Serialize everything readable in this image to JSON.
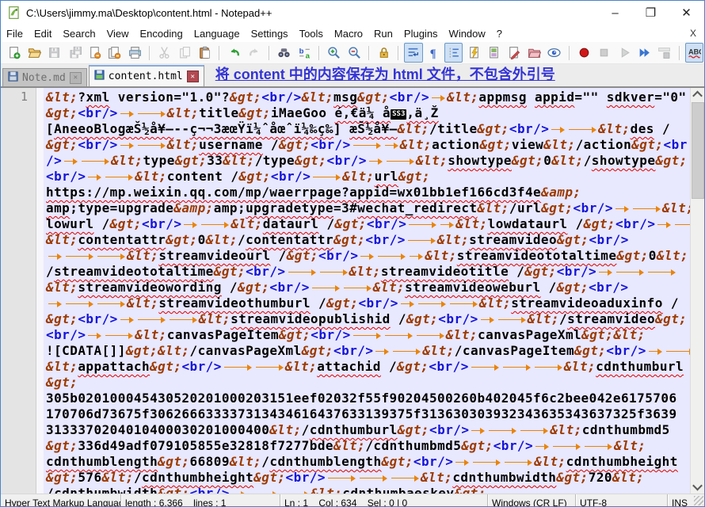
{
  "window": {
    "title": "C:\\Users\\jimmy.ma\\Desktop\\content.html - Notepad++",
    "minimize": "–",
    "maximize": "❐",
    "close": "✕"
  },
  "menu": {
    "items": [
      "File",
      "Edit",
      "Search",
      "View",
      "Encoding",
      "Language",
      "Settings",
      "Tools",
      "Macro",
      "Run",
      "Plugins",
      "Window",
      "?"
    ],
    "close_x": "X"
  },
  "toolbar": {
    "items": [
      {
        "name": "new-file"
      },
      {
        "name": "open-file"
      },
      {
        "name": "save-file",
        "disabled": true
      },
      {
        "name": "save-all",
        "disabled": true
      },
      {
        "name": "close-file"
      },
      {
        "name": "close-all"
      },
      {
        "name": "print"
      },
      {
        "sep": true
      },
      {
        "name": "cut",
        "disabled": true
      },
      {
        "name": "copy",
        "disabled": true
      },
      {
        "name": "paste"
      },
      {
        "sep": true
      },
      {
        "name": "undo"
      },
      {
        "name": "redo",
        "disabled": true
      },
      {
        "sep": true
      },
      {
        "name": "find"
      },
      {
        "name": "replace"
      },
      {
        "sep": true
      },
      {
        "name": "zoom-in"
      },
      {
        "name": "zoom-out"
      },
      {
        "sep": true
      },
      {
        "name": "sync-lock"
      },
      {
        "sep": true
      },
      {
        "name": "word-wrap",
        "active": true
      },
      {
        "name": "show-all-characters"
      },
      {
        "name": "indent-guide",
        "active": true
      },
      {
        "name": "user-language"
      },
      {
        "name": "document-map"
      },
      {
        "name": "document-edit"
      },
      {
        "name": "folder-workspace"
      },
      {
        "name": "file-monitoring"
      },
      {
        "sep": true
      },
      {
        "name": "macro-record"
      },
      {
        "name": "macro-stop",
        "disabled": true
      },
      {
        "name": "macro-play",
        "disabled": true
      },
      {
        "name": "macro-run-multiple"
      },
      {
        "name": "macro-save",
        "disabled": true
      },
      {
        "sep": true
      },
      {
        "name": "spell-check",
        "active": true
      }
    ]
  },
  "tabbar": {
    "tabs": [
      {
        "label": "Note.md",
        "state": "inactive",
        "close": "x"
      },
      {
        "label": "content.html",
        "state": "active",
        "close": "x"
      }
    ],
    "note": "将 content 中的内容保存为 html 文件，不包含外引号"
  },
  "editor": {
    "line_number": "1",
    "rows": [
      [
        [
          "e",
          "&lt;"
        ],
        [
          "t",
          "?"
        ],
        [
          "m",
          "xml"
        ],
        [
          "t",
          " version=\"1.0\"?"
        ],
        [
          "e",
          "&gt;"
        ],
        [
          "b",
          "<br/>"
        ],
        [
          "e",
          "&lt;"
        ],
        [
          "m",
          "msg"
        ],
        [
          "e",
          "&gt;"
        ],
        [
          "b",
          "<br/>"
        ],
        [
          "a"
        ],
        [
          "e",
          "&lt;"
        ],
        [
          "m",
          "appmsg"
        ],
        [
          "t",
          " "
        ],
        [
          "m",
          "appid"
        ],
        [
          "t",
          "=\"\" "
        ],
        [
          "m",
          "sdkver"
        ],
        [
          "t",
          "=\"0\""
        ]
      ],
      [
        [
          "e",
          "&gt;"
        ],
        [
          "b",
          "<br/>"
        ],
        [
          "a"
        ],
        [
          "A"
        ],
        [
          "e",
          "&lt;"
        ],
        [
          "t",
          "title"
        ],
        [
          "e",
          "&gt;"
        ],
        [
          "t",
          "iMaeGoo "
        ],
        [
          "m",
          "é‚€ä¼ å"
        ],
        [
          "k",
          "SS3"
        ],
        [
          "m",
          "‚ä¸Ž"
        ]
      ],
      [
        [
          "t",
          "["
        ],
        [
          "m",
          "AneeoBlogæŠ½å¥–"
        ],
        [
          "t",
          "--"
        ],
        [
          "m",
          "ç¬¬3æœŸï¼ˆåœˆï¼‰ç­‰"
        ],
        [
          "t",
          "] "
        ],
        [
          "m",
          "æŠ½å¥–"
        ],
        [
          "e",
          "&lt;"
        ],
        [
          "t",
          "/title"
        ],
        [
          "e",
          "&gt;"
        ],
        [
          "b",
          "<br/>"
        ],
        [
          "a"
        ],
        [
          "A"
        ],
        [
          "e",
          "&lt;"
        ],
        [
          "m",
          "des"
        ],
        [
          "t",
          " /"
        ]
      ],
      [
        [
          "e",
          "&gt;"
        ],
        [
          "b",
          "<br/>"
        ],
        [
          "a"
        ],
        [
          "A"
        ],
        [
          "e",
          "&lt;"
        ],
        [
          "m",
          "username"
        ],
        [
          "t",
          " /"
        ],
        [
          "e",
          "&gt;"
        ],
        [
          "b",
          "<br/>"
        ],
        [
          "A"
        ],
        [
          "a"
        ],
        [
          "e",
          "&lt;"
        ],
        [
          "t",
          "action"
        ],
        [
          "e",
          "&gt;"
        ],
        [
          "t",
          "view"
        ],
        [
          "e",
          "&lt;"
        ],
        [
          "t",
          "/action"
        ],
        [
          "e",
          "&gt;"
        ],
        [
          "b",
          "<br"
        ]
      ],
      [
        [
          "b",
          "/>"
        ],
        [
          "a"
        ],
        [
          "A"
        ],
        [
          "e",
          "&lt;"
        ],
        [
          "t",
          "type"
        ],
        [
          "e",
          "&gt;"
        ],
        [
          "t",
          "33"
        ],
        [
          "e",
          "&lt;"
        ],
        [
          "t",
          "/type"
        ],
        [
          "e",
          "&gt;"
        ],
        [
          "b",
          "<br/>"
        ],
        [
          "a"
        ],
        [
          "A"
        ],
        [
          "e",
          "&lt;"
        ],
        [
          "m",
          "showtype"
        ],
        [
          "e",
          "&gt;"
        ],
        [
          "t",
          "0"
        ],
        [
          "e",
          "&lt;"
        ],
        [
          "t",
          "/"
        ],
        [
          "m",
          "showtype"
        ],
        [
          "e",
          "&gt;"
        ]
      ],
      [
        [
          "b",
          "<br/>"
        ],
        [
          "a"
        ],
        [
          "A"
        ],
        [
          "e",
          "&lt;"
        ],
        [
          "t",
          "content /"
        ],
        [
          "e",
          "&gt;"
        ],
        [
          "b",
          "<br/>"
        ],
        [
          "A"
        ],
        [
          "e",
          "&lt;"
        ],
        [
          "m",
          "url"
        ],
        [
          "e",
          "&gt;"
        ]
      ],
      [
        [
          "m",
          "https://mp.weixin.qq.com/mp/waerrpage?appid=wx01bb1ef166cd3f4e"
        ],
        [
          "e",
          "&amp;"
        ]
      ],
      [
        [
          "m",
          "amp"
        ],
        [
          "t",
          ";type=upgrade"
        ],
        [
          "e",
          "&amp;"
        ],
        [
          "t",
          "amp;"
        ],
        [
          "m",
          "upgradetype"
        ],
        [
          "t",
          "=3#"
        ],
        [
          "m",
          "wechat_redirect"
        ],
        [
          "e",
          "&lt;"
        ],
        [
          "t",
          "/url"
        ],
        [
          "e",
          "&gt;"
        ],
        [
          "b",
          "<br/>"
        ],
        [
          "a"
        ],
        [
          "A"
        ],
        [
          "e",
          "&lt;"
        ]
      ],
      [
        [
          "m",
          "lowurl"
        ],
        [
          "t",
          " /"
        ],
        [
          "e",
          "&gt;"
        ],
        [
          "b",
          "<br/>"
        ],
        [
          "a"
        ],
        [
          "A"
        ],
        [
          "e",
          "&lt;"
        ],
        [
          "m",
          "dataurl"
        ],
        [
          "t",
          " /"
        ],
        [
          "e",
          "&gt;"
        ],
        [
          "b",
          "<br/>"
        ],
        [
          "A"
        ],
        [
          "a"
        ],
        [
          "e",
          "&lt;"
        ],
        [
          "m",
          "lowdataurl"
        ],
        [
          "t",
          " /"
        ],
        [
          "e",
          "&gt;"
        ],
        [
          "b",
          "<br/>"
        ],
        [
          "a"
        ],
        [
          "A"
        ]
      ],
      [
        [
          "e",
          "&lt;"
        ],
        [
          "m",
          "contentattr"
        ],
        [
          "e",
          "&gt;"
        ],
        [
          "t",
          "0"
        ],
        [
          "e",
          "&lt;"
        ],
        [
          "t",
          "/"
        ],
        [
          "m",
          "contentattr"
        ],
        [
          "e",
          "&gt;"
        ],
        [
          "b",
          "<br/>"
        ],
        [
          "A"
        ],
        [
          "e",
          "&lt;"
        ],
        [
          "m",
          "streamvideo"
        ],
        [
          "e",
          "&gt;"
        ],
        [
          "b",
          "<br/>"
        ]
      ],
      [
        [
          "a"
        ],
        [
          "A"
        ],
        [
          "A"
        ],
        [
          "e",
          "&lt;"
        ],
        [
          "m",
          "streamvideourl"
        ],
        [
          "t",
          " /"
        ],
        [
          "e",
          "&gt;"
        ],
        [
          "b",
          "<br/>"
        ],
        [
          "a"
        ],
        [
          "A"
        ],
        [
          "a"
        ],
        [
          "e",
          "&lt;"
        ],
        [
          "m",
          "streamvideototaltime"
        ],
        [
          "e",
          "&gt;"
        ],
        [
          "t",
          "0"
        ],
        [
          "e",
          "&lt;"
        ]
      ],
      [
        [
          "t",
          "/"
        ],
        [
          "m",
          "streamvideototaltime"
        ],
        [
          "e",
          "&gt;"
        ],
        [
          "b",
          "<br/>"
        ],
        [
          "A"
        ],
        [
          "A"
        ],
        [
          "e",
          "&lt;"
        ],
        [
          "m",
          "streamvideotitle"
        ],
        [
          "t",
          " /"
        ],
        [
          "e",
          "&gt;"
        ],
        [
          "b",
          "<br/>"
        ],
        [
          "a"
        ],
        [
          "A"
        ],
        [
          "A"
        ]
      ],
      [
        [
          "e",
          "&lt;"
        ],
        [
          "m",
          "streamvideowording"
        ],
        [
          "t",
          " /"
        ],
        [
          "e",
          "&gt;"
        ],
        [
          "b",
          "<br/>"
        ],
        [
          "A"
        ],
        [
          "A"
        ],
        [
          "e",
          "&lt;"
        ],
        [
          "m",
          "streamvideoweburl"
        ],
        [
          "t",
          " /"
        ],
        [
          "e",
          "&gt;"
        ],
        [
          "b",
          "<br/>"
        ]
      ],
      [
        [
          "a"
        ],
        [
          "A"
        ],
        [
          "A"
        ],
        [
          "e",
          "&lt;"
        ],
        [
          "m",
          "streamvideothumburl"
        ],
        [
          "t",
          " /"
        ],
        [
          "e",
          "&gt;"
        ],
        [
          "b",
          "<br/>"
        ],
        [
          "a"
        ],
        [
          "A"
        ],
        [
          "A"
        ],
        [
          "e",
          "&lt;"
        ],
        [
          "m",
          "streamvideoaduxinfo"
        ],
        [
          "t",
          " /"
        ]
      ],
      [
        [
          "e",
          "&gt;"
        ],
        [
          "b",
          "<br/>"
        ],
        [
          "a"
        ],
        [
          "A"
        ],
        [
          "A"
        ],
        [
          "e",
          "&lt;"
        ],
        [
          "m",
          "streamvideopublishid"
        ],
        [
          "t",
          " /"
        ],
        [
          "e",
          "&gt;"
        ],
        [
          "b",
          "<br/>"
        ],
        [
          "a"
        ],
        [
          "A"
        ],
        [
          "e",
          "&lt;"
        ],
        [
          "t",
          "/"
        ],
        [
          "m",
          "streamvideo"
        ],
        [
          "e",
          "&gt;"
        ]
      ],
      [
        [
          "b",
          "<br/>"
        ],
        [
          "a"
        ],
        [
          "A"
        ],
        [
          "e",
          "&lt;"
        ],
        [
          "t",
          "canvasPageItem"
        ],
        [
          "e",
          "&gt;"
        ],
        [
          "b",
          "<br/>"
        ],
        [
          "A"
        ],
        [
          "A"
        ],
        [
          "A"
        ],
        [
          "e",
          "&lt;"
        ],
        [
          "t",
          "canvasPageXml"
        ],
        [
          "e",
          "&gt;"
        ],
        [
          "e",
          "&lt;"
        ]
      ],
      [
        [
          "t",
          "![CDATA[]]"
        ],
        [
          "e",
          "&gt;"
        ],
        [
          "e",
          "&lt;"
        ],
        [
          "t",
          "/canvasPageXml"
        ],
        [
          "e",
          "&gt;"
        ],
        [
          "b",
          "<br/>"
        ],
        [
          "a"
        ],
        [
          "A"
        ],
        [
          "e",
          "&lt;"
        ],
        [
          "t",
          "/canvasPageItem"
        ],
        [
          "e",
          "&gt;"
        ],
        [
          "b",
          "<br/>"
        ],
        [
          "a"
        ],
        [
          "A"
        ]
      ],
      [
        [
          "e",
          "&lt;"
        ],
        [
          "m",
          "appattach"
        ],
        [
          "e",
          "&gt;"
        ],
        [
          "b",
          "<br/>"
        ],
        [
          "A"
        ],
        [
          "A"
        ],
        [
          "e",
          "&lt;"
        ],
        [
          "m",
          "attachid"
        ],
        [
          "t",
          " /"
        ],
        [
          "e",
          "&gt;"
        ],
        [
          "b",
          "<br/>"
        ],
        [
          "A"
        ],
        [
          "A"
        ],
        [
          "A"
        ],
        [
          "e",
          "&lt;"
        ],
        [
          "m",
          "cdnthumburl"
        ]
      ],
      [
        [
          "e",
          "&gt;"
        ]
      ],
      [
        [
          "t",
          "305b020100045430520201000203151eef02032f55f90204500260b402045f6c2bee042e6175706"
        ]
      ],
      [
        [
          "t",
          "170706d73675f306266633337313434616437633139375f313630303932343635343637325f3639"
        ]
      ],
      [
        [
          "t",
          "3133370204010400030201000400"
        ],
        [
          "e",
          "&lt;"
        ],
        [
          "t",
          "/"
        ],
        [
          "m",
          "cdnthumburl"
        ],
        [
          "e",
          "&gt;"
        ],
        [
          "b",
          "<br/>"
        ],
        [
          "a"
        ],
        [
          "A"
        ],
        [
          "A"
        ],
        [
          "e",
          "&lt;"
        ],
        [
          "t",
          "cdnthumbmd5"
        ]
      ],
      [
        [
          "e",
          "&gt;"
        ],
        [
          "t",
          "336d49adf079105855e32818f7277bde"
        ],
        [
          "e",
          "&lt;"
        ],
        [
          "t",
          "/cdnthumbmd5"
        ],
        [
          "e",
          "&gt;"
        ],
        [
          "b",
          "<br/>"
        ],
        [
          "a"
        ],
        [
          "A"
        ],
        [
          "A"
        ],
        [
          "e",
          "&lt;"
        ]
      ],
      [
        [
          "m",
          "cdnthumblength"
        ],
        [
          "e",
          "&gt;"
        ],
        [
          "t",
          "66809"
        ],
        [
          "e",
          "&lt;"
        ],
        [
          "t",
          "/"
        ],
        [
          "m",
          "cdnthumblength"
        ],
        [
          "e",
          "&gt;"
        ],
        [
          "b",
          "<br/>"
        ],
        [
          "a"
        ],
        [
          "A"
        ],
        [
          "A"
        ],
        [
          "e",
          "&lt;"
        ],
        [
          "m",
          "cdnthumbheight"
        ]
      ],
      [
        [
          "e",
          "&gt;"
        ],
        [
          "t",
          "576"
        ],
        [
          "e",
          "&lt;"
        ],
        [
          "t",
          "/"
        ],
        [
          "m",
          "cdnthumbheight"
        ],
        [
          "e",
          "&gt;"
        ],
        [
          "b",
          "<br/>"
        ],
        [
          "A"
        ],
        [
          "A"
        ],
        [
          "A"
        ],
        [
          "e",
          "&lt;"
        ],
        [
          "m",
          "cdnthumbwidth"
        ],
        [
          "e",
          "&gt;"
        ],
        [
          "t",
          "720"
        ],
        [
          "e",
          "&lt;"
        ]
      ],
      [
        [
          "t",
          "/"
        ],
        [
          "m",
          "cdnthumbwidth"
        ],
        [
          "e",
          "&gt;"
        ],
        [
          "b",
          "<br/>"
        ],
        [
          "a"
        ],
        [
          "A"
        ],
        [
          "A"
        ],
        [
          "e",
          "&lt;"
        ],
        [
          "m",
          "cdnthumbaeskey"
        ],
        [
          "e",
          "&gt;"
        ]
      ]
    ]
  },
  "status": {
    "doc_type": "Hyper Text Markup Language",
    "length_lines": "length : 6,366    lines : 1",
    "cursor": "Ln : 1    Col : 634    Sel : 0 | 0",
    "eol": "Windows (CR LF)",
    "encoding": "UTF-8",
    "mode": "INS"
  },
  "colors": {
    "entity": "#9c3a00",
    "tag_blue": "#1515d8",
    "tab_arrow_orange": "#e8840c",
    "current_line_bg": "#e8e8ff",
    "note_blue": "#3434d6",
    "squiggle_red": "#e00000"
  }
}
